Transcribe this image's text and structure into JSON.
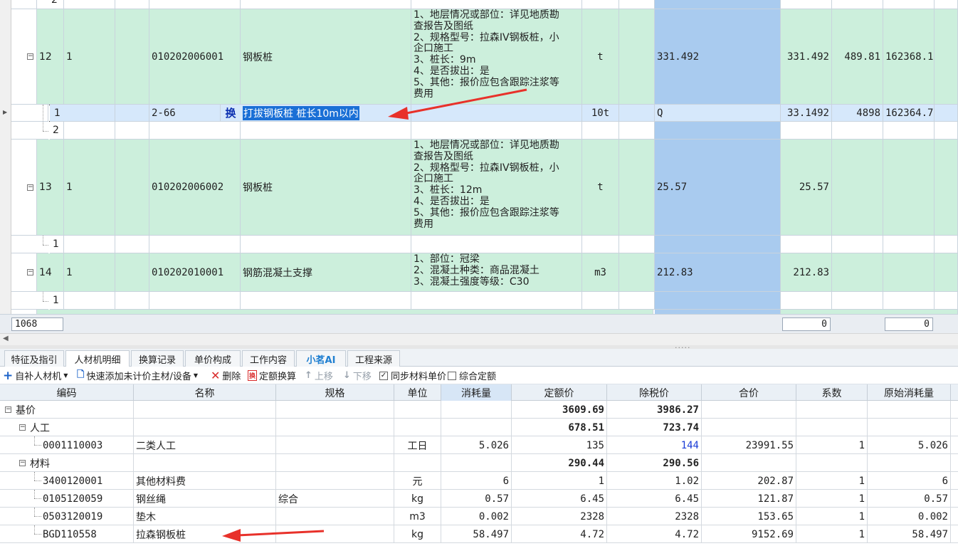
{
  "upper_grid": {
    "rows": [
      {
        "kind": "sub",
        "seq": "2"
      },
      {
        "kind": "item",
        "no": "12",
        "col2": "1",
        "code": "010202006001",
        "name": "钢板桩",
        "desc": "1、地层情况或部位：详见地质勘\n查报告及图纸\n2、规格型号：拉森IV钢板桩，小\n企口施工\n3、桩长：9m\n4、是否拔出：是\n5、其他：报价应包含跟踪注浆等\n费用",
        "unit": "t",
        "qty_expr": "331.492",
        "qty": "331.492",
        "price": "489.81",
        "total": "162368.1"
      },
      {
        "kind": "selected",
        "seq": "1",
        "code": "2-66",
        "mark": "换",
        "name": "打拔钢板桩 桩长10m以内",
        "unit": "10t",
        "qty_expr": "Q",
        "qty": "33.1492",
        "price": "4898",
        "total": "162364.7"
      },
      {
        "kind": "sub",
        "seq": "2"
      },
      {
        "kind": "item",
        "no": "13",
        "col2": "1",
        "code": "010202006002",
        "name": "钢板桩",
        "desc": "1、地层情况或部位：详见地质勘\n查报告及图纸\n2、规格型号：拉森IV钢板桩，小\n企口施工\n3、桩长：12m\n4、是否拔出：是\n5、其他：报价应包含跟踪注浆等\n费用",
        "unit": "t",
        "qty_expr": "25.57",
        "qty": "25.57",
        "price": "",
        "total": ""
      },
      {
        "kind": "sub",
        "seq": "1"
      },
      {
        "kind": "item",
        "no": "14",
        "col2": "1",
        "code": "010202010001",
        "name": "钢筋混凝土支撑",
        "desc": "1、部位：冠梁\n2、混凝土种类：商品混凝土\n3、混凝土强度等级：C30",
        "unit": "m3",
        "qty_expr": "212.83",
        "qty": "212.83",
        "price": "",
        "total": ""
      },
      {
        "kind": "sub",
        "seq": "1"
      }
    ],
    "footer": {
      "count": "1068",
      "sum_a": "0",
      "sum_b": "0"
    }
  },
  "tabs": [
    {
      "label": "特征及指引",
      "active": false
    },
    {
      "label": "人材机明细",
      "active": true
    },
    {
      "label": "换算记录",
      "active": false
    },
    {
      "label": "单价构成",
      "active": false
    },
    {
      "label": "工作内容",
      "active": false
    },
    {
      "label": "小茗AI",
      "active": false
    },
    {
      "label": "工程来源",
      "active": false
    }
  ],
  "toolbar": {
    "add_material": "自补人材机",
    "quick_add": "快速添加未计价主材/设备",
    "delete": "删除",
    "quota_convert": "定额换算",
    "move_up": "上移",
    "move_down": "下移",
    "sync_price": "同步材料单价",
    "sync_price_checked": true,
    "combined_quota": "综合定额",
    "combined_quota_checked": false
  },
  "lower_grid": {
    "headers": [
      "编码",
      "名称",
      "规格",
      "单位",
      "消耗量",
      "定额价",
      "除税价",
      "合价",
      "系数",
      "原始消耗量"
    ],
    "rows": [
      {
        "level": 0,
        "code": "基价",
        "name": "",
        "spec": "",
        "unit": "",
        "consumption": "",
        "quota": "3609.69",
        "taxfree": "3986.27",
        "total": "",
        "coef": "",
        "orig": ""
      },
      {
        "level": 1,
        "code": "人工",
        "name": "",
        "spec": "",
        "unit": "",
        "consumption": "",
        "quota": "678.51",
        "taxfree": "723.74",
        "total": "",
        "coef": "",
        "orig": ""
      },
      {
        "level": 2,
        "code": "0001110003",
        "name": "二类人工",
        "spec": "",
        "unit": "工日",
        "consumption": "5.026",
        "quota": "135",
        "taxfree": "144",
        "total": "23991.55",
        "coef": "1",
        "orig": "5.026"
      },
      {
        "level": 1,
        "code": "材料",
        "name": "",
        "spec": "",
        "unit": "",
        "consumption": "",
        "quota": "290.44",
        "taxfree": "290.56",
        "total": "",
        "coef": "",
        "orig": ""
      },
      {
        "level": 2,
        "code": "3400120001",
        "name": "其他材料费",
        "spec": "",
        "unit": "元",
        "consumption": "6",
        "quota": "1",
        "taxfree": "1.02",
        "total": "202.87",
        "coef": "1",
        "orig": "6"
      },
      {
        "level": 2,
        "code": "0105120059",
        "name": "钢丝绳",
        "spec": "综合",
        "unit": "kg",
        "consumption": "0.57",
        "quota": "6.45",
        "taxfree": "6.45",
        "total": "121.87",
        "coef": "1",
        "orig": "0.57"
      },
      {
        "level": 2,
        "code": "0503120019",
        "name": "垫木",
        "spec": "",
        "unit": "m3",
        "consumption": "0.002",
        "quota": "2328",
        "taxfree": "2328",
        "total": "153.65",
        "coef": "1",
        "orig": "0.002"
      },
      {
        "level": 2,
        "code": "BGD110558",
        "name": "拉森钢板桩",
        "spec": "",
        "unit": "kg",
        "consumption": "58.497",
        "quota": "4.72",
        "taxfree": "4.72",
        "total": "9152.69",
        "coef": "1",
        "orig": "58.497"
      }
    ]
  },
  "colors": {
    "item_row": "#ccefdc",
    "selected_row": "#d6e8fb",
    "qty_column": "#a9cbef",
    "annotation_arrow": "#e8312a",
    "link_value": "#1a3cd6"
  }
}
